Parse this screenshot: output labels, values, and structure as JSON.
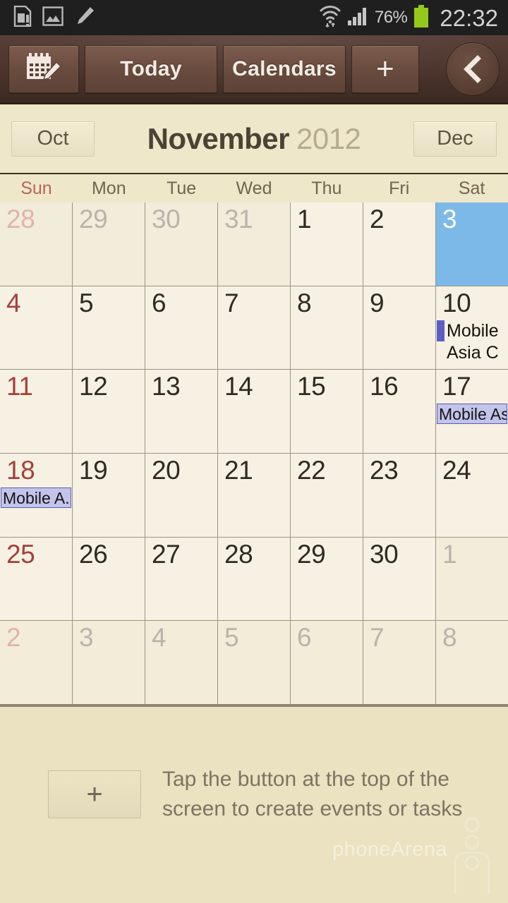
{
  "status_bar": {
    "icons_left": [
      "sim-card-icon",
      "image-icon",
      "pencil-icon"
    ],
    "wifi_icon": "wifi-transfer-icon",
    "signal_icon": "cellular-signal-icon",
    "battery_percent": "76%",
    "battery_icon": "battery-icon",
    "clock": "22:32",
    "battery_color": "#94c91a",
    "background": "#1f1f1f"
  },
  "toolbar": {
    "view_switch_icon": "calendar-edit-icon",
    "today_label": "Today",
    "calendars_label": "Calendars",
    "add_label": "+",
    "back_icon": "chevron-left-icon",
    "background": "#4a342c"
  },
  "month_bar": {
    "prev_label": "Oct",
    "next_label": "Dec",
    "month": "November",
    "year": "2012"
  },
  "weekdays": [
    {
      "label": "Sun",
      "is_sunday": true
    },
    {
      "label": "Mon",
      "is_sunday": false
    },
    {
      "label": "Tue",
      "is_sunday": false
    },
    {
      "label": "Wed",
      "is_sunday": false
    },
    {
      "label": "Thu",
      "is_sunday": false
    },
    {
      "label": "Fri",
      "is_sunday": false
    },
    {
      "label": "Sat",
      "is_sunday": false
    }
  ],
  "selected_color": "#7cb9e8",
  "event_accent_color": "#5c5ec6",
  "event_chip_color": "#c3c4ea",
  "weeks": [
    [
      {
        "day": "28",
        "state": "outside",
        "sunday": true,
        "selected": false,
        "events": []
      },
      {
        "day": "29",
        "state": "outside",
        "sunday": false,
        "selected": false,
        "events": []
      },
      {
        "day": "30",
        "state": "outside",
        "sunday": false,
        "selected": false,
        "events": []
      },
      {
        "day": "31",
        "state": "outside",
        "sunday": false,
        "selected": false,
        "events": []
      },
      {
        "day": "1",
        "state": "current",
        "sunday": false,
        "selected": false,
        "events": []
      },
      {
        "day": "2",
        "state": "current",
        "sunday": false,
        "selected": false,
        "events": []
      },
      {
        "day": "3",
        "state": "current",
        "sunday": false,
        "selected": true,
        "events": []
      }
    ],
    [
      {
        "day": "4",
        "state": "current",
        "sunday": true,
        "selected": false,
        "events": []
      },
      {
        "day": "5",
        "state": "current",
        "sunday": false,
        "selected": false,
        "events": []
      },
      {
        "day": "6",
        "state": "current",
        "sunday": false,
        "selected": false,
        "events": []
      },
      {
        "day": "7",
        "state": "current",
        "sunday": false,
        "selected": false,
        "events": []
      },
      {
        "day": "8",
        "state": "current",
        "sunday": false,
        "selected": false,
        "events": []
      },
      {
        "day": "9",
        "state": "current",
        "sunday": false,
        "selected": false,
        "events": []
      },
      {
        "day": "10",
        "state": "current",
        "sunday": false,
        "selected": false,
        "events": [
          {
            "title": "Mobile Asia Congr..",
            "style": "bar"
          }
        ]
      }
    ],
    [
      {
        "day": "11",
        "state": "current",
        "sunday": true,
        "selected": false,
        "events": []
      },
      {
        "day": "12",
        "state": "current",
        "sunday": false,
        "selected": false,
        "events": []
      },
      {
        "day": "13",
        "state": "current",
        "sunday": false,
        "selected": false,
        "events": []
      },
      {
        "day": "14",
        "state": "current",
        "sunday": false,
        "selected": false,
        "events": []
      },
      {
        "day": "15",
        "state": "current",
        "sunday": false,
        "selected": false,
        "events": []
      },
      {
        "day": "16",
        "state": "current",
        "sunday": false,
        "selected": false,
        "events": []
      },
      {
        "day": "17",
        "state": "current",
        "sunday": false,
        "selected": false,
        "events": [
          {
            "title": "Mobile As..",
            "style": "chip"
          }
        ]
      }
    ],
    [
      {
        "day": "18",
        "state": "current",
        "sunday": true,
        "selected": false,
        "events": [
          {
            "title": "Mobile A..",
            "style": "chip"
          }
        ]
      },
      {
        "day": "19",
        "state": "current",
        "sunday": false,
        "selected": false,
        "events": []
      },
      {
        "day": "20",
        "state": "current",
        "sunday": false,
        "selected": false,
        "events": []
      },
      {
        "day": "21",
        "state": "current",
        "sunday": false,
        "selected": false,
        "events": []
      },
      {
        "day": "22",
        "state": "current",
        "sunday": false,
        "selected": false,
        "events": []
      },
      {
        "day": "23",
        "state": "current",
        "sunday": false,
        "selected": false,
        "events": []
      },
      {
        "day": "24",
        "state": "current",
        "sunday": false,
        "selected": false,
        "events": []
      }
    ],
    [
      {
        "day": "25",
        "state": "current",
        "sunday": true,
        "selected": false,
        "events": []
      },
      {
        "day": "26",
        "state": "current",
        "sunday": false,
        "selected": false,
        "events": []
      },
      {
        "day": "27",
        "state": "current",
        "sunday": false,
        "selected": false,
        "events": []
      },
      {
        "day": "28",
        "state": "current",
        "sunday": false,
        "selected": false,
        "events": []
      },
      {
        "day": "29",
        "state": "current",
        "sunday": false,
        "selected": false,
        "events": []
      },
      {
        "day": "30",
        "state": "current",
        "sunday": false,
        "selected": false,
        "events": []
      },
      {
        "day": "1",
        "state": "outside",
        "sunday": false,
        "selected": false,
        "events": []
      }
    ],
    [
      {
        "day": "2",
        "state": "trailing",
        "sunday": true,
        "selected": false,
        "events": []
      },
      {
        "day": "3",
        "state": "trailing",
        "sunday": false,
        "selected": false,
        "events": []
      },
      {
        "day": "4",
        "state": "trailing",
        "sunday": false,
        "selected": false,
        "events": []
      },
      {
        "day": "5",
        "state": "trailing",
        "sunday": false,
        "selected": false,
        "events": []
      },
      {
        "day": "6",
        "state": "trailing",
        "sunday": false,
        "selected": false,
        "events": []
      },
      {
        "day": "7",
        "state": "trailing",
        "sunday": false,
        "selected": false,
        "events": []
      },
      {
        "day": "8",
        "state": "trailing",
        "sunday": false,
        "selected": false,
        "events": []
      }
    ]
  ],
  "hint": {
    "plus_label": "+",
    "text": "Tap the button at the top of the screen to create events or tasks",
    "watermark": "phoneArena"
  }
}
